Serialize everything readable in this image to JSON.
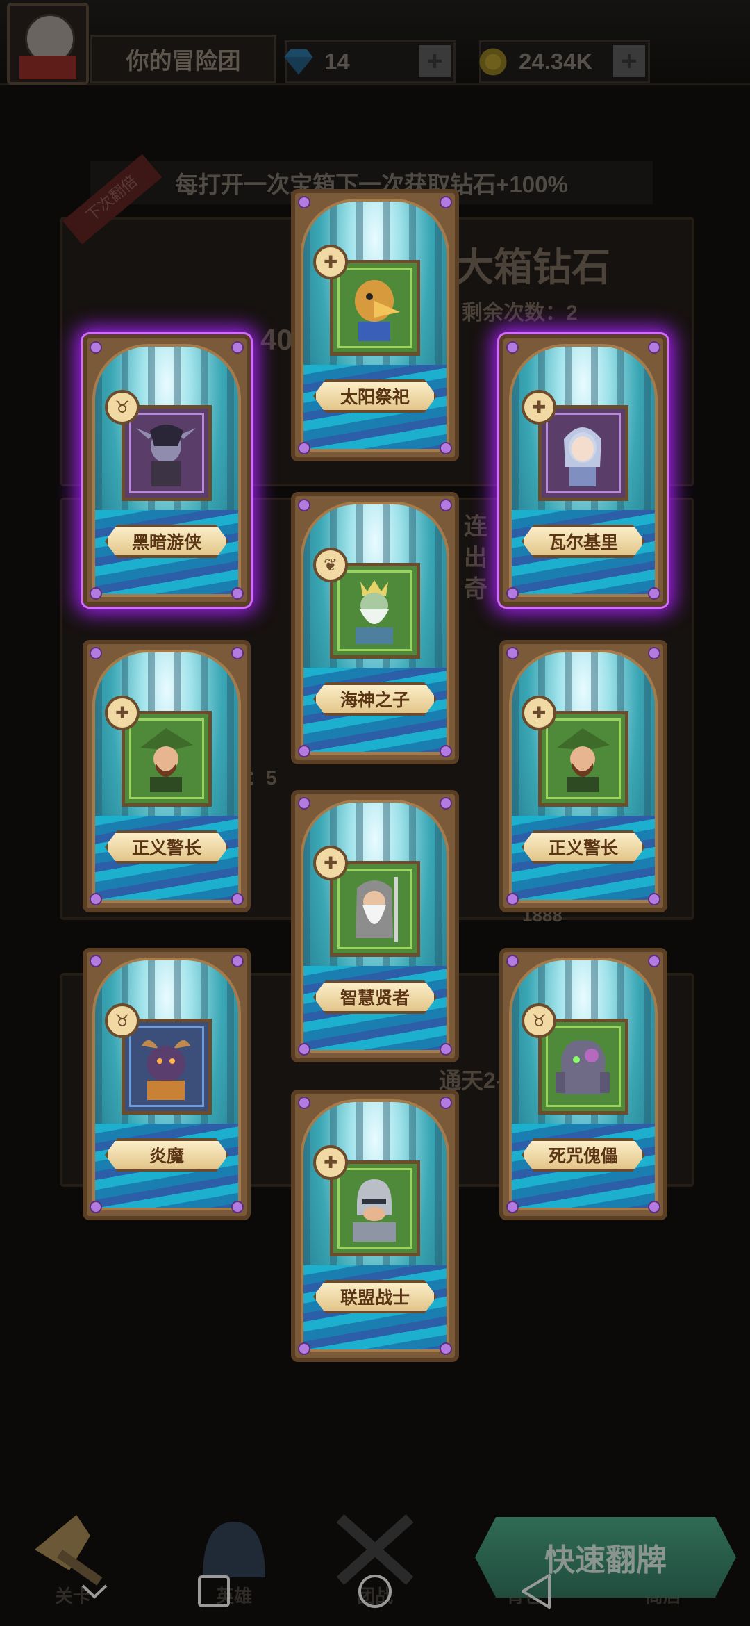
{
  "header": {
    "team_name": "你的冒险团",
    "gems": "14",
    "gold": "24.34K",
    "plus": "+"
  },
  "background": {
    "banner": "每打开一次宝箱下一次获取钻石+100%",
    "ribbon": "下次翻倍",
    "panel_title": "大箱钻石",
    "remaining": "剩余次数：2",
    "big_left": "40",
    "side_text_1": "连",
    "side_text_2": "出",
    "side_text_3": "奇",
    "count_label": "：5",
    "price": "1888",
    "stage": "通天2-1"
  },
  "cards": [
    {
      "name": "太阳祭祀",
      "class": "holy",
      "glow": false
    },
    {
      "name": "黑暗游侠",
      "class": "demon",
      "glow": true
    },
    {
      "name": "瓦尔基里",
      "class": "holy",
      "glow": true
    },
    {
      "name": "海神之子",
      "class": "nature",
      "glow": false
    },
    {
      "name": "正义警长",
      "class": "holy",
      "glow": false
    },
    {
      "name": "正义警长",
      "class": "holy",
      "glow": false
    },
    {
      "name": "智慧贤者",
      "class": "holy",
      "glow": false
    },
    {
      "name": "炎魔",
      "class": "demon",
      "glow": false
    },
    {
      "name": "死咒傀儡",
      "class": "demon",
      "glow": false
    },
    {
      "name": "联盟战士",
      "class": "holy",
      "glow": false
    }
  ],
  "bottom_nav": {
    "items": [
      "关卡",
      "英雄",
      "团战",
      "背包",
      "商店"
    ],
    "quick_flip": "快速翻牌"
  },
  "colors": {
    "glow": "#a020f0",
    "card_frame": "#7a5a38",
    "nameplate": "#f1d9a3",
    "quick_flip": "#2f6b55"
  }
}
